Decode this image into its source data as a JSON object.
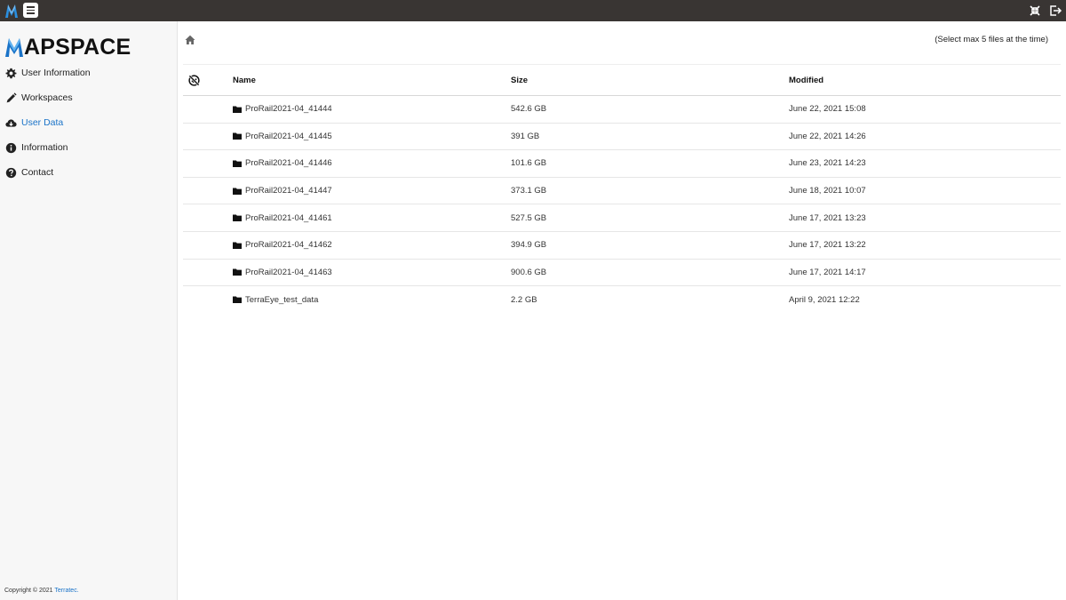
{
  "brand": {
    "name": "APSPACE",
    "logo_letter": "M",
    "accent": "#1a73c8"
  },
  "sidebar": {
    "items": [
      {
        "label": "User Information",
        "icon": "gear-icon"
      },
      {
        "label": "Workspaces",
        "icon": "pencil-icon"
      },
      {
        "label": "User Data",
        "icon": "cloud-download-icon",
        "active": true
      },
      {
        "label": "Information",
        "icon": "info-icon"
      },
      {
        "label": "Contact",
        "icon": "question-icon"
      }
    ],
    "copyright_prefix": "Copyright © 2021 ",
    "copyright_link": "Terratec."
  },
  "main": {
    "hint": "(Select max 5 files at the time)",
    "columns": {
      "name": "Name",
      "size": "Size",
      "modified": "Modified"
    },
    "rows": [
      {
        "name": "ProRail2021-04_41444",
        "size": "542.6 GB",
        "modified": "June 22, 2021 15:08"
      },
      {
        "name": "ProRail2021-04_41445",
        "size": "391 GB",
        "modified": "June 22, 2021 14:26"
      },
      {
        "name": "ProRail2021-04_41446",
        "size": "101.6 GB",
        "modified": "June 23, 2021 14:23"
      },
      {
        "name": "ProRail2021-04_41447",
        "size": "373.1 GB",
        "modified": "June 18, 2021 10:07"
      },
      {
        "name": "ProRail2021-04_41461",
        "size": "527.5 GB",
        "modified": "June 17, 2021 13:23"
      },
      {
        "name": "ProRail2021-04_41462",
        "size": "394.9 GB",
        "modified": "June 17, 2021 13:22"
      },
      {
        "name": "ProRail2021-04_41463",
        "size": "900.6 GB",
        "modified": "June 17, 2021 14:17"
      },
      {
        "name": "TerraEye_test_data",
        "size": "2.2 GB",
        "modified": "April 9, 2021 12:22"
      }
    ]
  }
}
